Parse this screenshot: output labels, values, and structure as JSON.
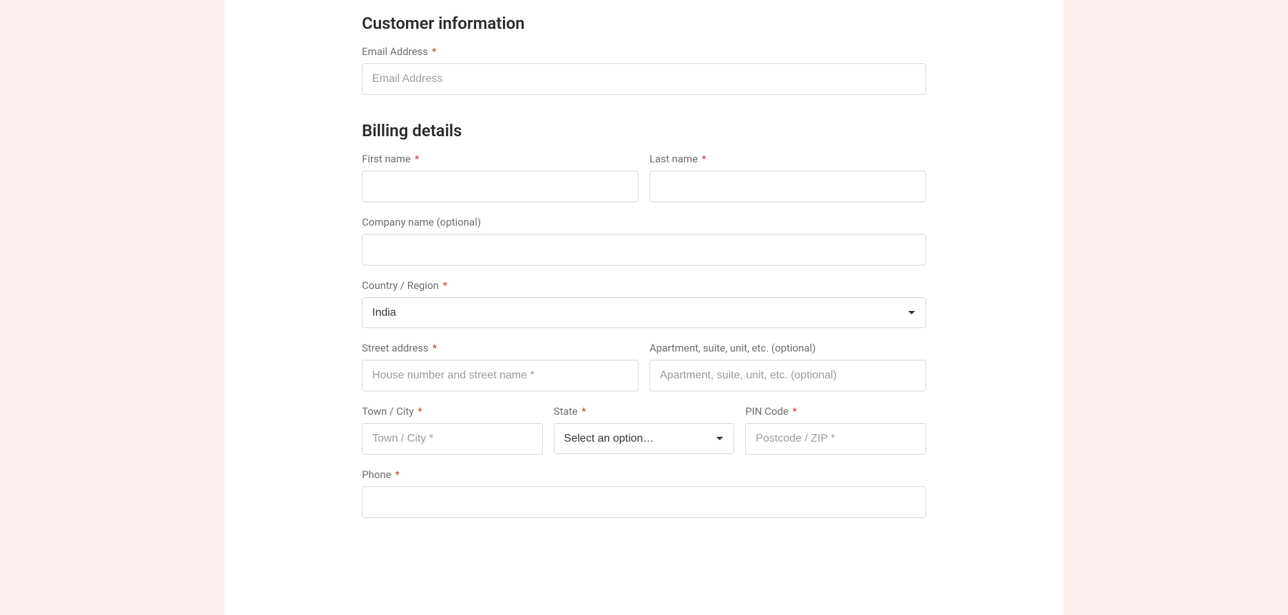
{
  "customer": {
    "heading": "Customer information",
    "email_label": "Email Address",
    "email_placeholder": "Email Address"
  },
  "billing": {
    "heading": "Billing details",
    "first_name_label": "First name",
    "last_name_label": "Last name",
    "company_label": "Company name (optional)",
    "country_label": "Country / Region",
    "country_value": "India",
    "street_label": "Street address",
    "street_placeholder": "House number and street name *",
    "apt_label": "Apartment, suite, unit, etc. (optional)",
    "apt_placeholder": "Apartment, suite, unit, etc. (optional)",
    "city_label": "Town / City",
    "city_placeholder": "Town / City *",
    "state_label": "State",
    "state_value": "Select an option…",
    "pin_label": "PIN Code",
    "pin_placeholder": "Postcode / ZIP *",
    "phone_label": "Phone"
  },
  "required_mark": "*"
}
